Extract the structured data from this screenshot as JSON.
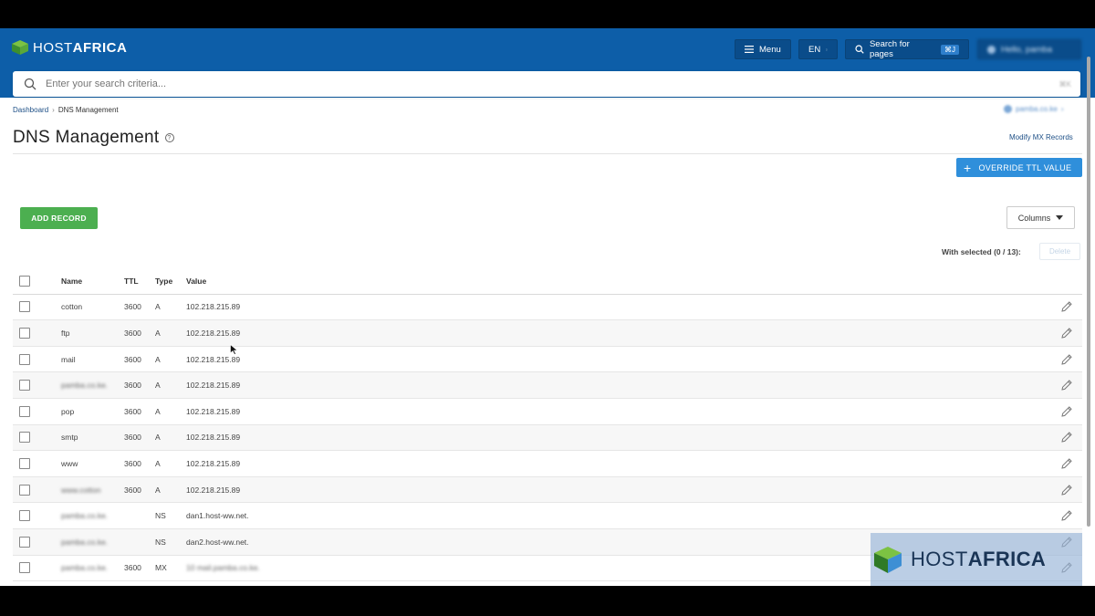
{
  "app": {
    "logo_text_light": "HOST",
    "logo_text_bold": "AFRICA"
  },
  "topbar": {
    "menu_label": "Menu",
    "lang_label": "EN",
    "search_pages_label": "Search for pages",
    "search_pages_shortcut": "⌘J",
    "hello_label": "Hello, pamba"
  },
  "search": {
    "placeholder": "Enter your search criteria...",
    "shortcut": "⌘K"
  },
  "breadcrumb": {
    "items": [
      "Dashboard",
      "DNS Management"
    ],
    "separator": "›"
  },
  "domain_selector": {
    "value": "pamba.co.ke"
  },
  "page": {
    "title": "DNS Management",
    "help_glyph": "?",
    "modify_mx_link": "Modify MX Records",
    "override_ttl_label": "OVERRIDE TTL VALUE",
    "add_record_label": "ADD RECORD",
    "columns_label": "Columns",
    "with_selected_label": "With selected (0 / 13):",
    "delete_label": "Delete"
  },
  "table": {
    "headers": {
      "name": "Name",
      "ttl": "TTL",
      "type": "Type",
      "value": "Value"
    },
    "rows": [
      {
        "name": "cotton",
        "ttl": "3600",
        "type": "A",
        "value": "102.218.215.89",
        "name_blurred": false,
        "value_blurred": false
      },
      {
        "name": "ftp",
        "ttl": "3600",
        "type": "A",
        "value": "102.218.215.89",
        "name_blurred": false,
        "value_blurred": false
      },
      {
        "name": "mail",
        "ttl": "3600",
        "type": "A",
        "value": "102.218.215.89",
        "name_blurred": false,
        "value_blurred": false
      },
      {
        "name": "pamba.co.ke.",
        "ttl": "3600",
        "type": "A",
        "value": "102.218.215.89",
        "name_blurred": true,
        "value_blurred": false
      },
      {
        "name": "pop",
        "ttl": "3600",
        "type": "A",
        "value": "102.218.215.89",
        "name_blurred": false,
        "value_blurred": false
      },
      {
        "name": "smtp",
        "ttl": "3600",
        "type": "A",
        "value": "102.218.215.89",
        "name_blurred": false,
        "value_blurred": false
      },
      {
        "name": "www",
        "ttl": "3600",
        "type": "A",
        "value": "102.218.215.89",
        "name_blurred": false,
        "value_blurred": false
      },
      {
        "name": "www.cotton",
        "ttl": "3600",
        "type": "A",
        "value": "102.218.215.89",
        "name_blurred": true,
        "value_blurred": false
      },
      {
        "name": "pamba.co.ke.",
        "ttl": "",
        "type": "NS",
        "value": "dan1.host-ww.net.",
        "name_blurred": true,
        "value_blurred": false
      },
      {
        "name": "pamba.co.ke.",
        "ttl": "",
        "type": "NS",
        "value": "dan2.host-ww.net.",
        "name_blurred": true,
        "value_blurred": false
      },
      {
        "name": "pamba.co.ke.",
        "ttl": "3600",
        "type": "MX",
        "value": "10 mail.pamba.co.ke.",
        "name_blurred": true,
        "value_blurred": true
      }
    ]
  },
  "watermark": {
    "text_light": "HOST",
    "text_bold": "AFRICA"
  },
  "colors": {
    "topbar": "#0d5ea8",
    "primary_button": "#2f8fdb",
    "add_button": "#4caf50",
    "link": "#1d4f86"
  }
}
